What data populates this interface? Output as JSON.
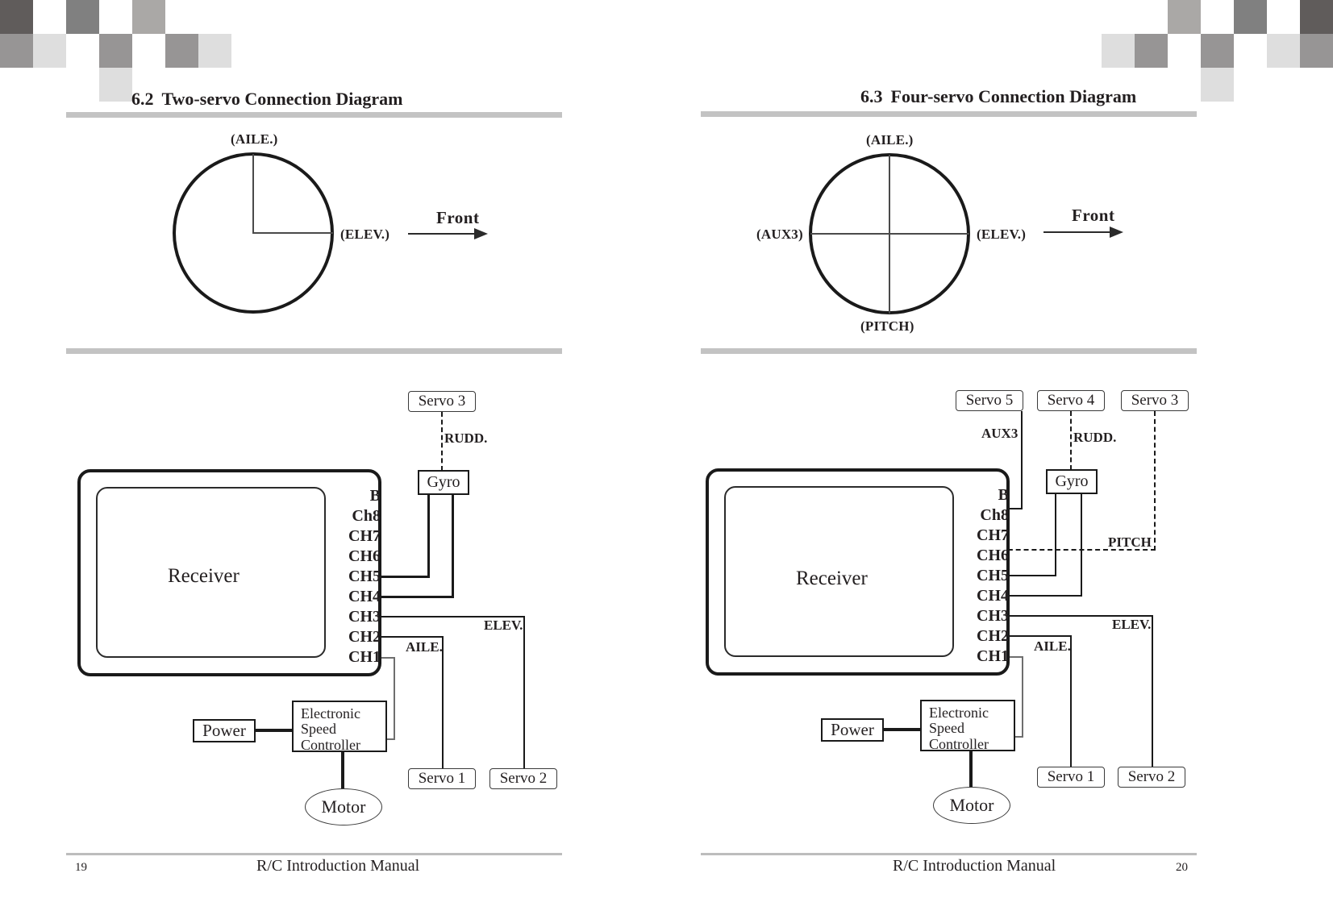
{
  "document": {
    "manual_title": "R/C Introduction Manual"
  },
  "left_page": {
    "page_number": "19",
    "section": {
      "number": "6.2",
      "title": "Two-servo Connection Diagram"
    },
    "swashplate": {
      "labels": {
        "top": "(AILE.)",
        "right": "(ELEV.)"
      },
      "front_label": "Front"
    },
    "receiver": {
      "name": "Receiver",
      "pins": [
        "B",
        "Ch8",
        "CH7",
        "CH6",
        "CH5",
        "CH4",
        "CH3",
        "CH2",
        "CH1"
      ]
    },
    "components": {
      "servo3": "Servo 3",
      "gyro": "Gyro",
      "power": "Power",
      "esc_line1": "Electronic",
      "esc_line2": "Speed",
      "esc_line3": "Controller",
      "motor": "Motor",
      "servo1": "Servo 1",
      "servo2": "Servo 2"
    },
    "wire_labels": {
      "rudd": "RUDD.",
      "elev": "ELEV.",
      "aile": "AILE."
    }
  },
  "right_page": {
    "page_number": "20",
    "section": {
      "number": "6.3",
      "title": "Four-servo Connection Diagram"
    },
    "swashplate": {
      "labels": {
        "top": "(AILE.)",
        "right": "(ELEV.)",
        "left": "(AUX3)",
        "bottom": "(PITCH)"
      },
      "front_label": "Front"
    },
    "receiver": {
      "name": "Receiver",
      "pins": [
        "B",
        "Ch8",
        "CH7",
        "CH6",
        "CH5",
        "CH4",
        "CH3",
        "CH2",
        "CH1"
      ]
    },
    "components": {
      "servo5": "Servo 5",
      "servo4": "Servo 4",
      "servo3": "Servo 3",
      "gyro": "Gyro",
      "power": "Power",
      "esc_line1": "Electronic",
      "esc_line2": "Speed",
      "esc_line3": "Controller",
      "motor": "Motor",
      "servo1": "Servo 1",
      "servo2": "Servo 2"
    },
    "wire_labels": {
      "aux3": "AUX3",
      "rudd": "RUDD.",
      "pitch": "PITCH",
      "elev": "ELEV.",
      "aile": "AILE."
    }
  },
  "decor": {
    "colors": {
      "dark": "#605c5b",
      "mid": "#808080",
      "gray": "#979595",
      "light": "#aaa8a6",
      "pale": "#dedede"
    }
  }
}
